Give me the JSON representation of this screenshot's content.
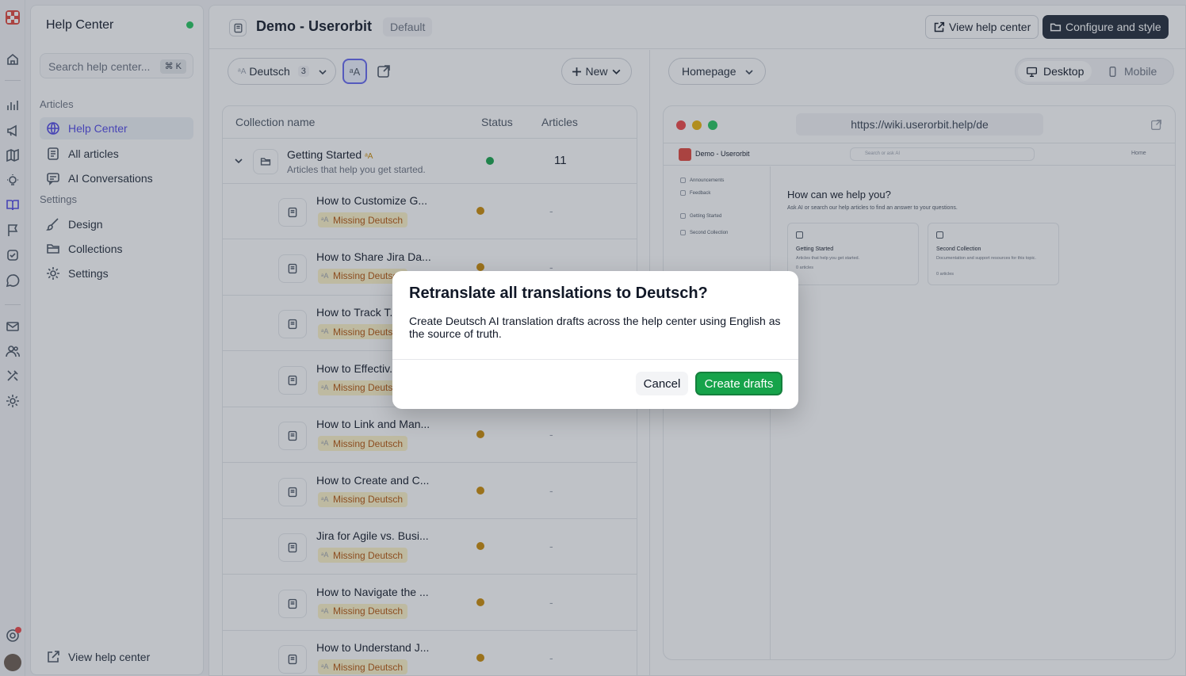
{
  "colors": {
    "accent": "#4f46e5",
    "success": "#16a34a",
    "warning": "#ca8a04",
    "brand": "#e1453a"
  },
  "sidebar": {
    "title": "Help Center",
    "search_placeholder": "Search help center...",
    "search_shortcut": "⌘ K",
    "section_articles": "Articles",
    "section_settings": "Settings",
    "items": [
      {
        "label": "Help Center",
        "icon": "globe-icon",
        "active": true
      },
      {
        "label": "All articles",
        "icon": "document-icon"
      },
      {
        "label": "AI Conversations",
        "icon": "chat-icon"
      },
      {
        "label": "Design",
        "icon": "brush-icon"
      },
      {
        "label": "Collections",
        "icon": "folder-icon"
      },
      {
        "label": "Settings",
        "icon": "gear-icon"
      }
    ],
    "footer_label": "View help center"
  },
  "header": {
    "title": "Demo - Userorbit",
    "badge": "Default",
    "view_label": "View help center",
    "configure_label": "Configure and style"
  },
  "toolbar": {
    "language": "Deutsch",
    "language_count": "3",
    "new_label": "New"
  },
  "table": {
    "col_name": "Collection name",
    "col_status": "Status",
    "col_articles": "Articles",
    "group": {
      "title": "Getting Started",
      "subtitle": "Articles that help you get started.",
      "count": "11",
      "status": "published"
    },
    "missing_label": "Missing Deutsch",
    "dash": "-",
    "rows": [
      {
        "title": "How to Customize G..."
      },
      {
        "title": "How to Share Jira Da..."
      },
      {
        "title": "How to Track T..."
      },
      {
        "title": "How to Effectiv..."
      },
      {
        "title": "How to Link and Man..."
      },
      {
        "title": "How to Create and C..."
      },
      {
        "title": "Jira for Agile vs. Busi..."
      },
      {
        "title": "How to Navigate the ..."
      },
      {
        "title": "How to Understand J..."
      }
    ]
  },
  "preview": {
    "page_select": "Homepage",
    "desktop": "Desktop",
    "mobile": "Mobile",
    "url": "https://wiki.userorbit.help/de",
    "site_name": "Demo - Userorbit",
    "search_placeholder": "Search or ask AI",
    "home_link": "Home",
    "nav": [
      "Announcements",
      "Feedback",
      "Getting Started",
      "Second Collection"
    ],
    "hero_title": "How can we help you?",
    "hero_subtitle": "Ask AI or search our help articles to find an answer to your questions.",
    "cards": [
      {
        "title": "Getting Started",
        "desc": "Articles that help you get started.",
        "count": "0 articles"
      },
      {
        "title": "Second Collection",
        "desc": "Documentation and support resources for this topic.",
        "count": "0 articles"
      }
    ]
  },
  "dialog": {
    "title": "Retranslate all translations to Deutsch?",
    "body": "Create Deutsch AI translation drafts across the help center using English as the source of truth.",
    "cancel": "Cancel",
    "confirm": "Create drafts"
  }
}
